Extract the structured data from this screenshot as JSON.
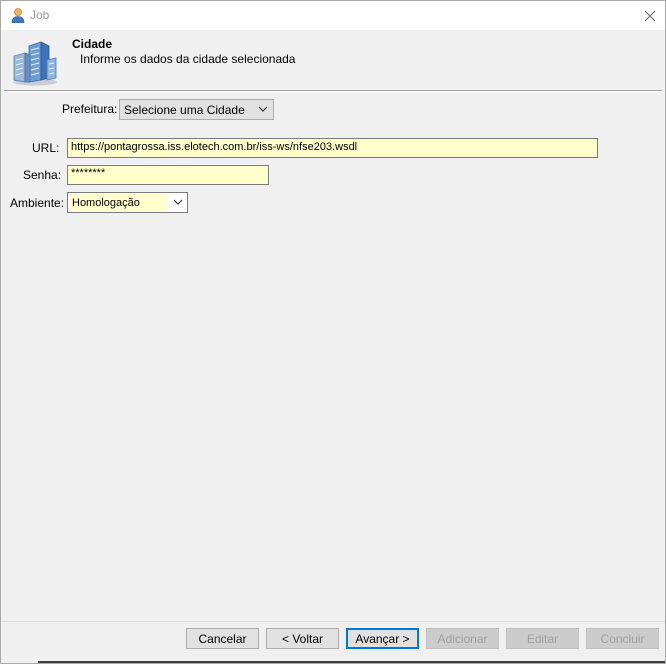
{
  "window": {
    "title": "Job",
    "icon": "user-icon",
    "close_icon": "close-icon"
  },
  "header": {
    "title": "Cidade",
    "subtitle": "Informe os dados da cidade selecionada",
    "icon": "buildings-icon"
  },
  "form": {
    "prefeitura": {
      "label": "Prefeitura:",
      "value": "Selecione uma Cidade"
    },
    "url": {
      "label": "URL:",
      "value": "https://pontagrossa.iss.elotech.com.br/iss-ws/nfse203.wsdl"
    },
    "senha": {
      "label": "Senha:",
      "value": "********"
    },
    "ambiente": {
      "label": "Ambiente:",
      "value": "Homologação"
    }
  },
  "buttons": {
    "cancelar": "Cancelar",
    "voltar": "< Voltar",
    "avancar": "Avançar >",
    "adicionar": "Adicionar",
    "editar": "Editar",
    "concluir": "Concluir"
  },
  "colors": {
    "field_highlight": "#ffffcc",
    "default_button_border": "#0078d7",
    "window_bg": "#f0f0f0"
  }
}
